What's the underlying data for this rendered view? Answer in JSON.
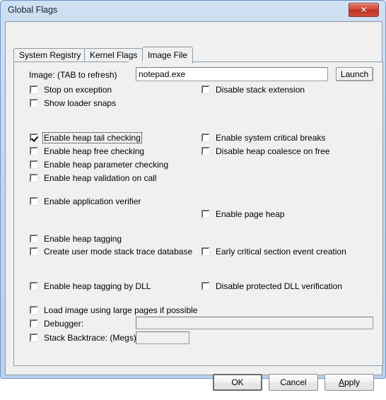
{
  "window": {
    "title": "Global Flags",
    "close_label": "✕",
    "titlebar_color": "#c3d8ee",
    "close_color": "#cf4a37"
  },
  "tabs": [
    {
      "label": "System Registry",
      "selected": false
    },
    {
      "label": "Kernel Flags",
      "selected": false
    },
    {
      "label": "Image File",
      "selected": true
    }
  ],
  "image_row": {
    "label": "Image: (TAB to refresh)",
    "value": "notepad.exe",
    "placeholder": "",
    "launch_label": "Launch"
  },
  "checkboxes": {
    "stop_on_exception": {
      "label": "Stop on exception",
      "checked": false,
      "focused": false
    },
    "disable_stack_extension": {
      "label": "Disable stack extension",
      "checked": false,
      "focused": false
    },
    "show_loader_snaps": {
      "label": "Show loader snaps",
      "checked": false,
      "focused": false
    },
    "enable_heap_tail_checking": {
      "label": "Enable heap tail checking",
      "checked": true,
      "focused": true
    },
    "enable_system_critical_breaks": {
      "label": "Enable system critical breaks",
      "checked": false,
      "focused": false
    },
    "enable_heap_free_checking": {
      "label": "Enable heap free checking",
      "checked": false,
      "focused": false
    },
    "disable_heap_coalesce_on_free": {
      "label": "Disable heap coalesce on free",
      "checked": false,
      "focused": false
    },
    "enable_heap_parameter_checking": {
      "label": "Enable heap parameter checking",
      "checked": false,
      "focused": false
    },
    "enable_heap_validation_on_call": {
      "label": "Enable heap validation on call",
      "checked": false,
      "focused": false
    },
    "enable_application_verifier": {
      "label": "Enable application verifier",
      "checked": false,
      "focused": false
    },
    "enable_page_heap": {
      "label": "Enable page heap",
      "checked": false,
      "focused": false
    },
    "enable_heap_tagging": {
      "label": "Enable heap tagging",
      "checked": false,
      "focused": false
    },
    "create_user_mode_stack_trace_database": {
      "label": "Create user mode stack trace database",
      "checked": false,
      "focused": false
    },
    "early_critical_section_event_creation": {
      "label": "Early critical section event creation",
      "checked": false,
      "focused": false
    },
    "enable_heap_tagging_by_dll": {
      "label": "Enable heap tagging by DLL",
      "checked": false,
      "focused": false
    },
    "disable_protected_dll_verification": {
      "label": "Disable protected DLL verification",
      "checked": false,
      "focused": false
    },
    "load_image_using_large_pages": {
      "label": "Load image using large pages if possible",
      "checked": false,
      "focused": false
    },
    "debugger": {
      "label": "Debugger:",
      "checked": false,
      "focused": false
    },
    "stack_backtrace": {
      "label": "Stack Backtrace: (Megs)",
      "checked": false,
      "focused": false
    }
  },
  "fields": {
    "debugger_value": "",
    "stack_backtrace_value": ""
  },
  "buttons": {
    "ok": "OK",
    "cancel": "Cancel",
    "apply_prefix": "A",
    "apply_rest": "pply"
  }
}
